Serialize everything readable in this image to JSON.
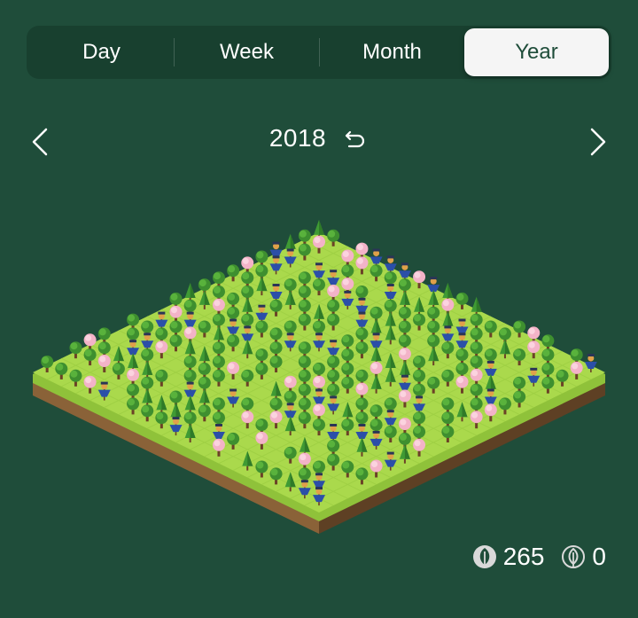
{
  "tabs": [
    {
      "label": "Day",
      "active": false
    },
    {
      "label": "Week",
      "active": false
    },
    {
      "label": "Month",
      "active": false
    },
    {
      "label": "Year",
      "active": true
    }
  ],
  "period": {
    "year": "2018",
    "prev_icon": "chevron-left-icon",
    "next_icon": "chevron-right-icon",
    "reset_icon": "undo-icon"
  },
  "forest": {
    "view": "isometric-grid",
    "tree_types": [
      "green-tree",
      "pine",
      "cherry-blossom",
      "blue-scarecrow"
    ]
  },
  "stats": {
    "healthy_trees": "265",
    "dead_trees": "0",
    "healthy_icon": "leaf-icon",
    "dead_icon": "withered-leaf-icon"
  },
  "colors": {
    "background": "#1f4d3a",
    "segment_bg": "#18402f",
    "active_segment": "#f5f5f5",
    "grass": "#a9d94a",
    "dirt": "#7a5530"
  }
}
